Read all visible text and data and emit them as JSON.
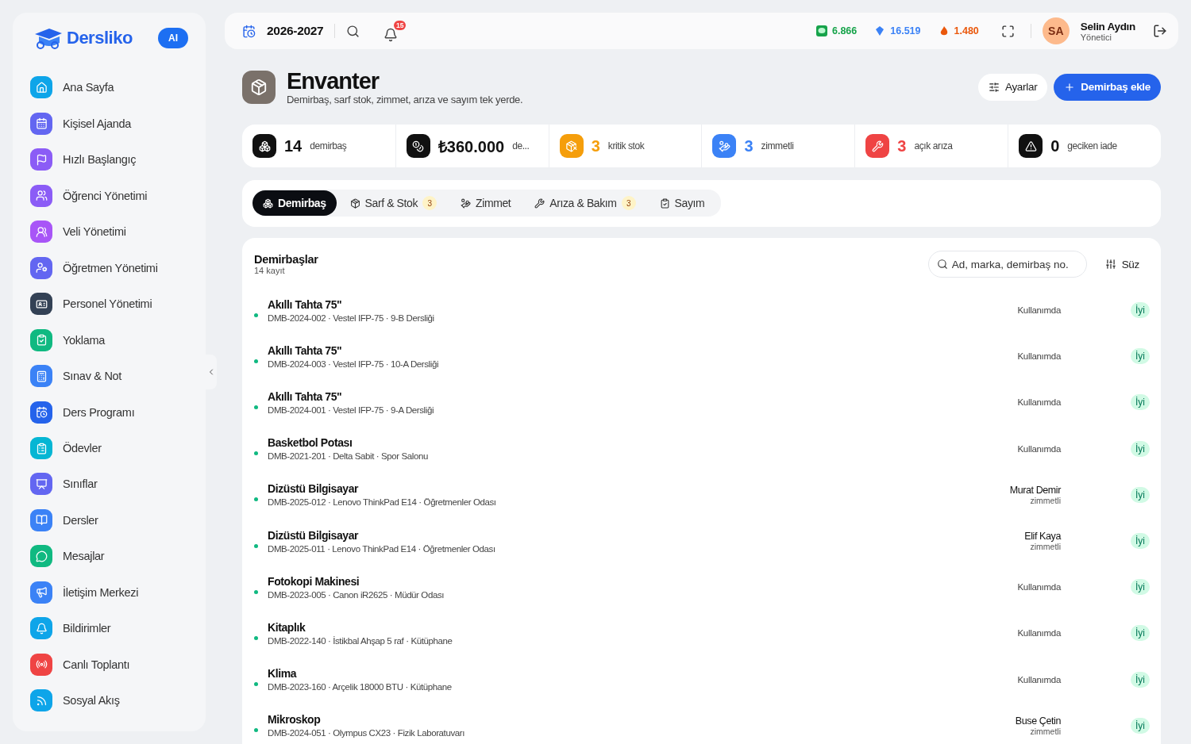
{
  "brand": {
    "name": "Dersliko",
    "ai_badge": "AI"
  },
  "sidebar": {
    "items": [
      {
        "label": "Ana Sayfa",
        "color": "#0ea5e9"
      },
      {
        "label": "Kişisel Ajanda",
        "color": "#6366f1"
      },
      {
        "label": "Hızlı Başlangıç",
        "color": "#8b5cf6"
      },
      {
        "label": "Öğrenci Yönetimi",
        "color": "#8b5cf6"
      },
      {
        "label": "Veli Yönetimi",
        "color": "#a855f7"
      },
      {
        "label": "Öğretmen Yönetimi",
        "color": "#6366f1"
      },
      {
        "label": "Personel Yönetimi",
        "color": "#334155"
      },
      {
        "label": "Yoklama",
        "color": "#10b981"
      },
      {
        "label": "Sınav & Not",
        "color": "#3b82f6"
      },
      {
        "label": "Ders Programı",
        "color": "#2563eb"
      },
      {
        "label": "Ödevler",
        "color": "#06b6d4"
      },
      {
        "label": "Sınıflar",
        "color": "#6366f1"
      },
      {
        "label": "Dersler",
        "color": "#3b82f6"
      },
      {
        "label": "Mesajlar",
        "color": "#10b981"
      },
      {
        "label": "İletişim Merkezi",
        "color": "#3b82f6"
      },
      {
        "label": "Bildirimler",
        "color": "#0ea5e9"
      },
      {
        "label": "Canlı Toplantı",
        "color": "#ef4444"
      },
      {
        "label": "Sosyal Akış",
        "color": "#0ea5e9"
      }
    ]
  },
  "topbar": {
    "year": "2026-2027",
    "notification_count": "15",
    "counters": [
      {
        "value": "6.866",
        "color": "#16a34a"
      },
      {
        "value": "16.519",
        "color": "#3b82f6"
      },
      {
        "value": "1.480",
        "color": "#ea580c"
      }
    ],
    "user": {
      "initials": "SA",
      "name": "Selin Aydın",
      "role": "Yönetici"
    }
  },
  "header": {
    "title": "Envanter",
    "subtitle": "Demirbaş, sarf stok, zimmet, arıza ve sayım tek yerde.",
    "buttons": [
      {
        "label": "Ayarlar",
        "kind": "secondary"
      },
      {
        "label": "Demirbaş ekle",
        "kind": "primary"
      }
    ]
  },
  "stats": [
    {
      "value": "14",
      "label": "demirbaş",
      "color": "#111111"
    },
    {
      "value": "₺360.000",
      "label": "de...",
      "color": "#111111"
    },
    {
      "value": "3",
      "label": "kritik stok",
      "color": "#f59e0b"
    },
    {
      "value": "3",
      "label": "zimmetli",
      "color": "#3b82f6"
    },
    {
      "value": "3",
      "label": "açık arıza",
      "color": "#ef4444"
    },
    {
      "value": "0",
      "label": "geciken iade",
      "color": "#111111"
    }
  ],
  "tabs": [
    {
      "label": "Demirbaş",
      "selected": true
    },
    {
      "label": "Sarf & Stok",
      "count": "3",
      "selected": false
    },
    {
      "label": "Zimmet",
      "selected": false
    },
    {
      "label": "Arıza & Bakım",
      "count": "3",
      "selected": false
    },
    {
      "label": "Sayım",
      "selected": false
    }
  ],
  "list": {
    "title": "Demirbaşlar",
    "subtitle": "14 kayıt",
    "search": {
      "placeholder": "Ad, marka, demirbaş no."
    },
    "filter_button": "Süz",
    "rows": [
      {
        "name": "Akıllı Tahta 75\"",
        "details": "DMB-2024-002 · Vestel IFP-75 · 9-B Dersliği",
        "kind": "status",
        "status": "Kullanımda",
        "condition": "İyi",
        "color": "#10b981"
      },
      {
        "name": "Akıllı Tahta 75\"",
        "details": "DMB-2024-003 · Vestel IFP-75 · 10-A Dersliği",
        "kind": "status",
        "status": "Kullanımda",
        "condition": "İyi",
        "color": "#10b981"
      },
      {
        "name": "Akıllı Tahta 75\"",
        "details": "DMB-2024-001 · Vestel IFP-75 · 9-A Dersliği",
        "kind": "status",
        "status": "Kullanımda",
        "condition": "İyi",
        "color": "#10b981"
      },
      {
        "name": "Basketbol Potası",
        "details": "DMB-2021-201 · Delta Sabit · Spor Salonu",
        "kind": "status",
        "status": "Kullanımda",
        "condition": "İyi",
        "color": "#10b981"
      },
      {
        "name": "Dizüstü Bilgisayar",
        "details": "DMB-2025-012 · Lenovo ThinkPad E14 · Öğretmenler Odası",
        "kind": "assigned",
        "assignee": "Murat Demir",
        "note": "zimmetli",
        "condition": "İyi",
        "color": "#10b981"
      },
      {
        "name": "Dizüstü Bilgisayar",
        "details": "DMB-2025-011 · Lenovo ThinkPad E14 · Öğretmenler Odası",
        "kind": "assigned",
        "assignee": "Elif Kaya",
        "note": "zimmetli",
        "condition": "İyi",
        "color": "#10b981"
      },
      {
        "name": "Fotokopi Makinesi",
        "details": "DMB-2023-005 · Canon iR2625 · Müdür Odası",
        "kind": "status",
        "status": "Kullanımda",
        "condition": "İyi",
        "color": "#10b981"
      },
      {
        "name": "Kitaplık",
        "details": "DMB-2022-140 · İstikbal Ahşap 5 raf · Kütüphane",
        "kind": "status",
        "status": "Kullanımda",
        "condition": "İyi",
        "color": "#10b981"
      },
      {
        "name": "Klima",
        "details": "DMB-2023-160 · Arçelik 18000 BTU · Kütüphane",
        "kind": "status",
        "status": "Kullanımda",
        "condition": "İyi",
        "color": "#10b981"
      },
      {
        "name": "Mikroskop",
        "details": "DMB-2024-051 · Olympus CX23 · Fizik Laboratuvarı",
        "kind": "assigned",
        "assignee": "Buse Çetin",
        "note": "zimmetli",
        "condition": "İyi",
        "color": "#10b981"
      }
    ]
  }
}
